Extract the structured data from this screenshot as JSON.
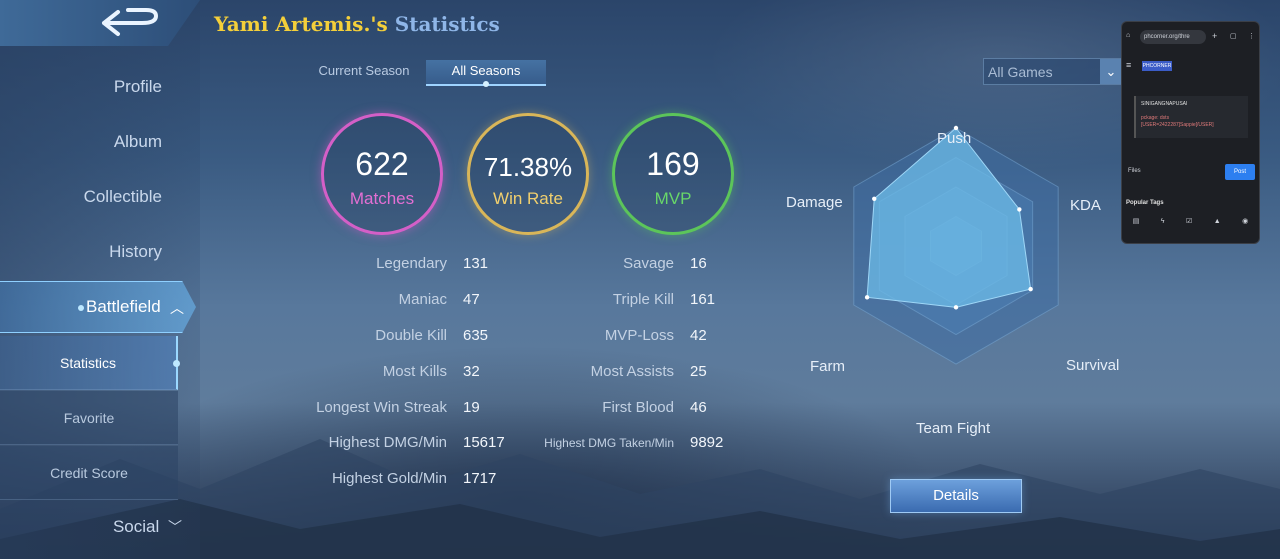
{
  "header": {
    "player_name": "Yami Artemis.'s",
    "title_suffix": "Statistics"
  },
  "sidebar": {
    "items": [
      {
        "label": "Profile"
      },
      {
        "label": "Album"
      },
      {
        "label": "Collectible"
      },
      {
        "label": "History"
      }
    ],
    "active": {
      "label": "Battlefield",
      "chevron": "❮"
    },
    "subitems": [
      {
        "label": "Statistics"
      },
      {
        "label": "Favorite"
      },
      {
        "label": "Credit Score"
      }
    ],
    "social": {
      "label": "Social",
      "chevron": "⌄"
    }
  },
  "tabs": {
    "current": "Current Season",
    "all": "All Seasons"
  },
  "filter": {
    "selected": "All Games"
  },
  "summary": {
    "matches": {
      "value": "622",
      "label": "Matches"
    },
    "win_rate": {
      "value": "71.38%",
      "label": "Win Rate"
    },
    "mvp": {
      "value": "169",
      "label": "MVP"
    }
  },
  "stats_left": [
    {
      "label": "Legendary",
      "value": "131"
    },
    {
      "label": "Maniac",
      "value": "47"
    },
    {
      "label": "Double Kill",
      "value": "635"
    },
    {
      "label": "Most Kills",
      "value": "32"
    },
    {
      "label": "Longest Win Streak",
      "value": "19"
    },
    {
      "label": "Highest DMG/Min",
      "value": "15617"
    },
    {
      "label": "Highest Gold/Min",
      "value": "1717"
    }
  ],
  "stats_right": [
    {
      "label": "Savage",
      "value": "16"
    },
    {
      "label": "Triple Kill",
      "value": "161"
    },
    {
      "label": "MVP-Loss",
      "value": "42"
    },
    {
      "label": "Most Assists",
      "value": "25"
    },
    {
      "label": "First Blood",
      "value": "46"
    },
    {
      "label": "Highest DMG Taken/Min",
      "value": "9892"
    }
  ],
  "radar": {
    "axes": [
      "Push",
      "KDA",
      "Survival",
      "Team Fight",
      "Farm",
      "Damage"
    ],
    "values": [
      1.0,
      0.62,
      0.73,
      0.52,
      0.87,
      0.8
    ],
    "fill_color": "#6ab8e6"
  },
  "details_button": "Details",
  "phone_overlay": {
    "url": "phcorner.org/thre",
    "logo": "PHCORNER",
    "editor_line1": "SINIGANGNAPUSAI",
    "editor_line2": "pckage: dsts",
    "editor_line3": "[USER=2422287]Sappie[/USER]",
    "files": "Files",
    "post": "Post",
    "tags": "Popular Tags"
  }
}
